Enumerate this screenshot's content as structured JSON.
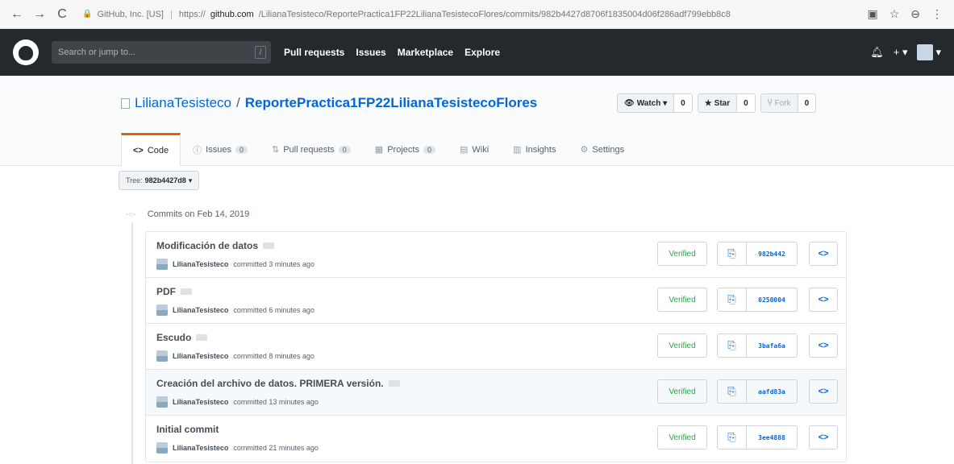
{
  "browser": {
    "back": "←",
    "forward": "→",
    "reload": "C",
    "site_identity": "GitHub, Inc. [US]",
    "url_prefix": "https://",
    "url_domain": "github.com",
    "url_path": "/LilianaTesisteco/ReportePractica1FP22LilianaTesistecoFlores/commits/982b4427d8706f1835004d06f286adf799ebb8c8"
  },
  "header": {
    "search_placeholder": "Search or jump to...",
    "search_shortcut": "/",
    "nav": [
      "Pull requests",
      "Issues",
      "Marketplace",
      "Explore"
    ],
    "plus": "+ ▾"
  },
  "repo": {
    "owner": "LilianaTesisteco",
    "slash": "/",
    "name": "ReportePractica1FP22LilianaTesistecoFlores",
    "watch_label": "Watch ▾",
    "watch_count": "0",
    "star_label": "Star",
    "star_count": "0",
    "fork_label": "Fork",
    "fork_count": "0"
  },
  "tabs": [
    {
      "icon": "<>",
      "label": "Code"
    },
    {
      "icon": "ⓘ",
      "label": "Issues",
      "count": "0"
    },
    {
      "icon": "⇅",
      "label": "Pull requests",
      "count": "0"
    },
    {
      "icon": "▦",
      "label": "Projects",
      "count": "0"
    },
    {
      "icon": "▤",
      "label": "Wiki"
    },
    {
      "icon": "▥",
      "label": "Insights"
    },
    {
      "icon": "⚙",
      "label": "Settings"
    }
  ],
  "tree": {
    "label": "Tree:",
    "value": "982b4427d8",
    "caret": "▾"
  },
  "commit_group": {
    "title": "Commits on Feb 14, 2019"
  },
  "commits": [
    {
      "message": "Modificación de datos",
      "author": "LilianaTesisteco",
      "action": "committed 3 minutes ago",
      "verified": "Verified",
      "sha": "982b442"
    },
    {
      "message": "PDF",
      "author": "LilianaTesisteco",
      "action": "committed 6 minutes ago",
      "verified": "Verified",
      "sha": "0250004"
    },
    {
      "message": "Escudo",
      "author": "LilianaTesisteco",
      "action": "committed 8 minutes ago",
      "verified": "Verified",
      "sha": "3bafa6a"
    },
    {
      "message": "Creación del archivo de datos. PRIMERA versión.",
      "author": "LilianaTesisteco",
      "action": "committed 13 minutes ago",
      "verified": "Verified",
      "sha": "aafd83a"
    },
    {
      "message": "Initial commit",
      "author": "LilianaTesisteco",
      "action": "committed 21 minutes ago",
      "verified": "Verified",
      "sha": "3ee4888"
    }
  ],
  "colors": {
    "header_bg": "#24292e",
    "link": "#0366d6",
    "tab_accent": "#e36209",
    "verified": "#28a745"
  }
}
